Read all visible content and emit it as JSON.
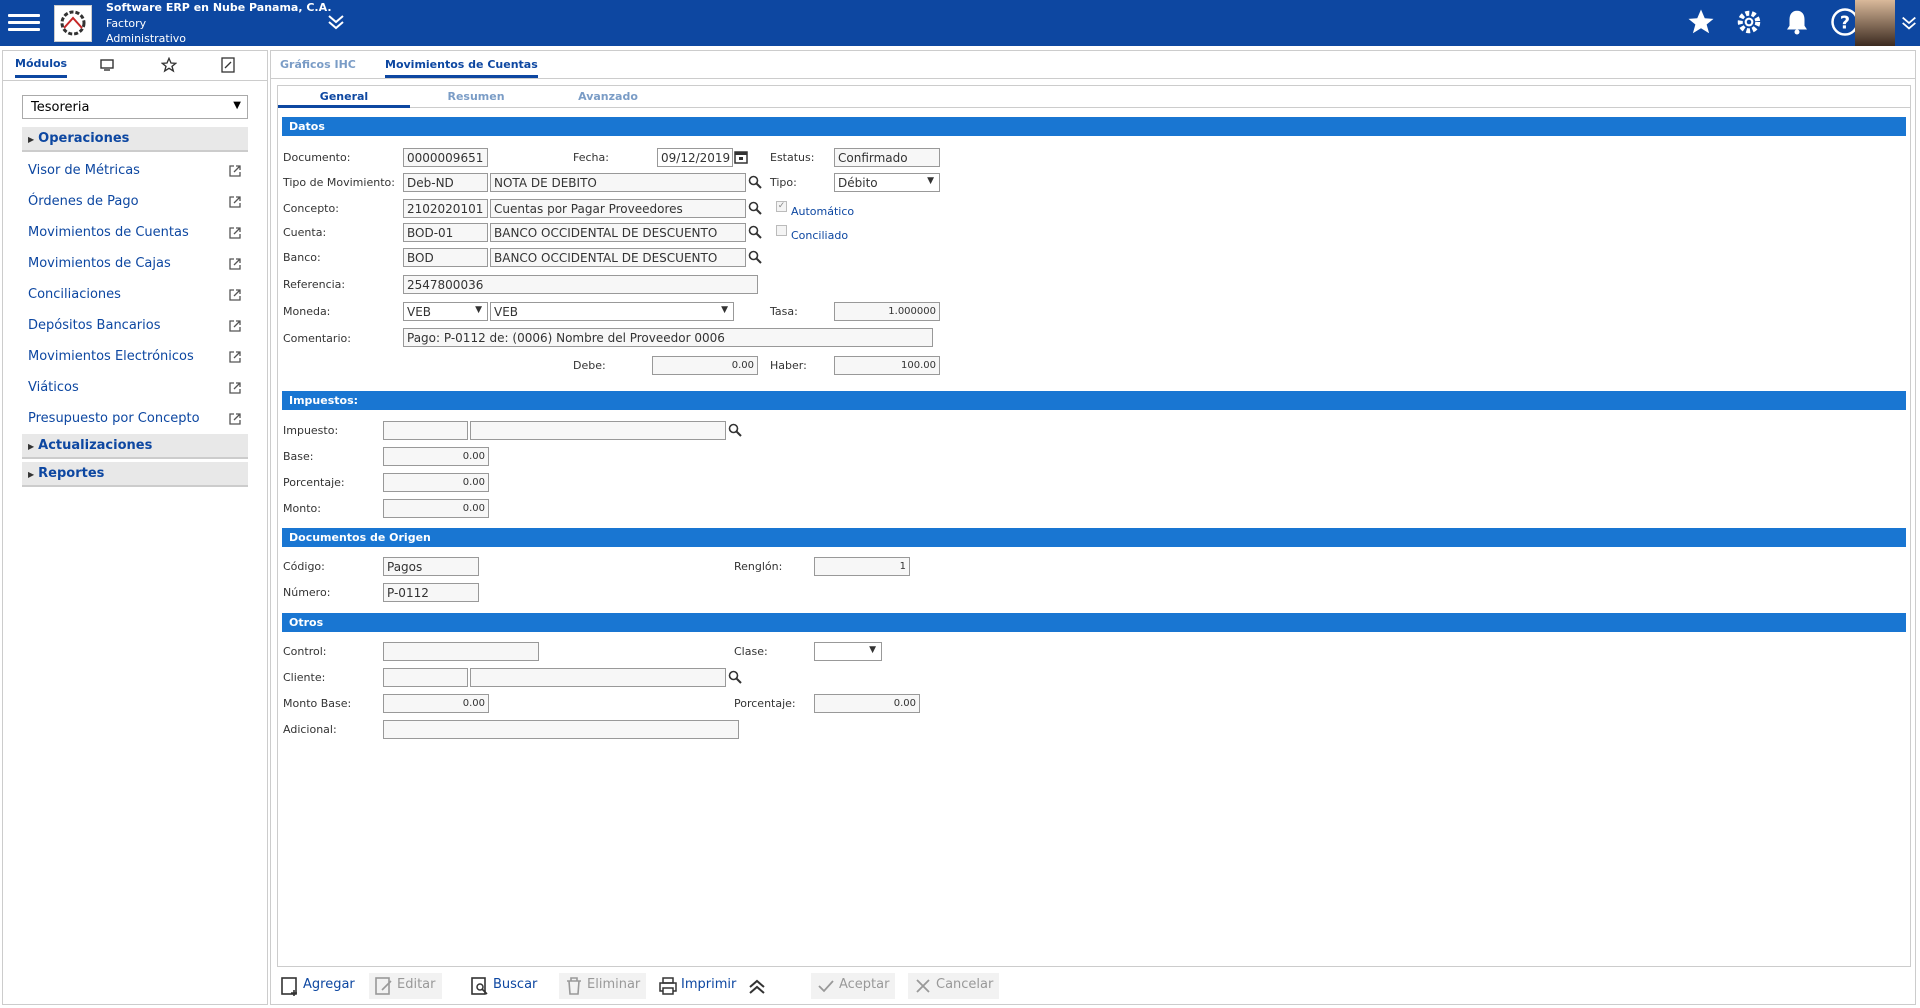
{
  "header": {
    "company": "Software ERP en Nube Panama, C.A.",
    "subsidiary": "Factory",
    "role": "Administrativo"
  },
  "left_panel": {
    "tabs": [
      "Módulos"
    ],
    "module_select": "Tesoreria",
    "sections": {
      "operaciones": "Operaciones",
      "actualizaciones": "Actualizaciones",
      "reportes": "Reportes"
    },
    "items": [
      "Visor de Métricas",
      "Órdenes de Pago",
      "Movimientos de Cuentas",
      "Movimientos de Cajas",
      "Conciliaciones",
      "Depósitos Bancarios",
      "Movimientos Electrónicos",
      "Viáticos",
      "Presupuesto por Concepto"
    ]
  },
  "main": {
    "tabs": [
      "Gráficos IHC",
      "Movimientos de Cuentas"
    ],
    "subtabs": [
      "General",
      "Resumen",
      "Avanzado"
    ]
  },
  "datos": {
    "title": "Datos",
    "documento_label": "Documento:",
    "documento": "0000009651",
    "fecha_label": "Fecha:",
    "fecha": "09/12/2019",
    "estatus_label": "Estatus:",
    "estatus": "Confirmado",
    "tipo_mov_label": "Tipo de Movimiento:",
    "tipo_mov_code": "Deb-ND",
    "tipo_mov_desc": "NOTA DE DEBITO",
    "tipo_label": "Tipo:",
    "tipo": "Débito",
    "concepto_label": "Concepto:",
    "concepto_code": "2102020101",
    "concepto_desc": "Cuentas por Pagar Proveedores",
    "automatico_label": "Automático",
    "conciliado_label": "Conciliado",
    "cuenta_label": "Cuenta:",
    "cuenta_code": "BOD-01",
    "cuenta_desc": "BANCO OCCIDENTAL DE DESCUENTO",
    "banco_label": "Banco:",
    "banco_code": "BOD",
    "banco_desc": "BANCO OCCIDENTAL DE DESCUENTO",
    "referencia_label": "Referencia:",
    "referencia": "2547800036",
    "moneda_label": "Moneda:",
    "moneda_code": "VEB",
    "moneda_desc": "VEB",
    "tasa_label": "Tasa:",
    "tasa": "1.000000",
    "comentario_label": "Comentario:",
    "comentario": "Pago: P-0112 de: (0006) Nombre del Proveedor 0006",
    "debe_label": "Debe:",
    "debe": "0.00",
    "haber_label": "Haber:",
    "haber": "100.00"
  },
  "impuestos": {
    "title": "Impuestos:",
    "impuesto_label": "Impuesto:",
    "base_label": "Base:",
    "base": "0.00",
    "porcentaje_label": "Porcentaje:",
    "porcentaje": "0.00",
    "monto_label": "Monto:",
    "monto": "0.00"
  },
  "origen": {
    "title": "Documentos de Origen",
    "codigo_label": "Código:",
    "codigo": "Pagos",
    "renglon_label": "Renglón:",
    "renglon": "1",
    "numero_label": "Número:",
    "numero": "P-0112"
  },
  "otros": {
    "title": "Otros",
    "control_label": "Control:",
    "clase_label": "Clase:",
    "cliente_label": "Cliente:",
    "monto_base_label": "Monto Base:",
    "monto_base": "0.00",
    "porcentaje_label": "Porcentaje:",
    "porcentaje": "0.00",
    "adicional_label": "Adicional:"
  },
  "toolbar": {
    "agregar": "Agregar",
    "editar": "Editar",
    "buscar": "Buscar",
    "eliminar": "Eliminar",
    "imprimir": "Imprimir",
    "aceptar": "Aceptar",
    "cancelar": "Cancelar"
  }
}
